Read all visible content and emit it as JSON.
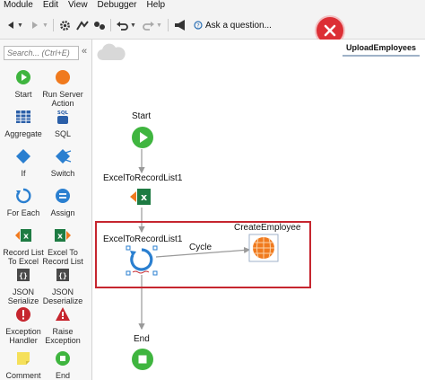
{
  "menu": [
    "Module",
    "Edit",
    "View",
    "Debugger",
    "Help"
  ],
  "toolbar": {
    "ask_label": "Ask a question..."
  },
  "palette": {
    "search_placeholder": "Search... (Ctrl+E)",
    "tools": [
      {
        "label": "Start"
      },
      {
        "label": "Run Server\nAction"
      },
      {
        "label": "Aggregate"
      },
      {
        "label": "SQL"
      },
      {
        "label": "If"
      },
      {
        "label": "Switch"
      },
      {
        "label": "For Each"
      },
      {
        "label": "Assign"
      },
      {
        "label": "Record List\nTo Excel"
      },
      {
        "label": "Excel To\nRecord List"
      },
      {
        "label": "JSON\nSerialize"
      },
      {
        "label": "JSON\nDeserialize"
      },
      {
        "label": "Exception\nHandler"
      },
      {
        "label": "Raise\nException"
      },
      {
        "label": "Comment"
      },
      {
        "label": "End"
      }
    ]
  },
  "canvas": {
    "tab_title": "UploadEmployees",
    "nodes": {
      "start": "Start",
      "excel_to_record_list_1": "ExcelToRecordList1",
      "foreach_label": "ExcelToRecordList1",
      "create_employee": "CreateEmployee",
      "cycle": "Cycle",
      "end": "End"
    }
  },
  "colors": {
    "start_green": "#3fb53f",
    "end_green": "#3fb53f",
    "close_red": "#dc2f35",
    "highlight_red": "#c6262f",
    "excel_green": "#1e7b43",
    "foreach_blue": "#2a7fd0",
    "action_orange": "#f07a1e"
  }
}
